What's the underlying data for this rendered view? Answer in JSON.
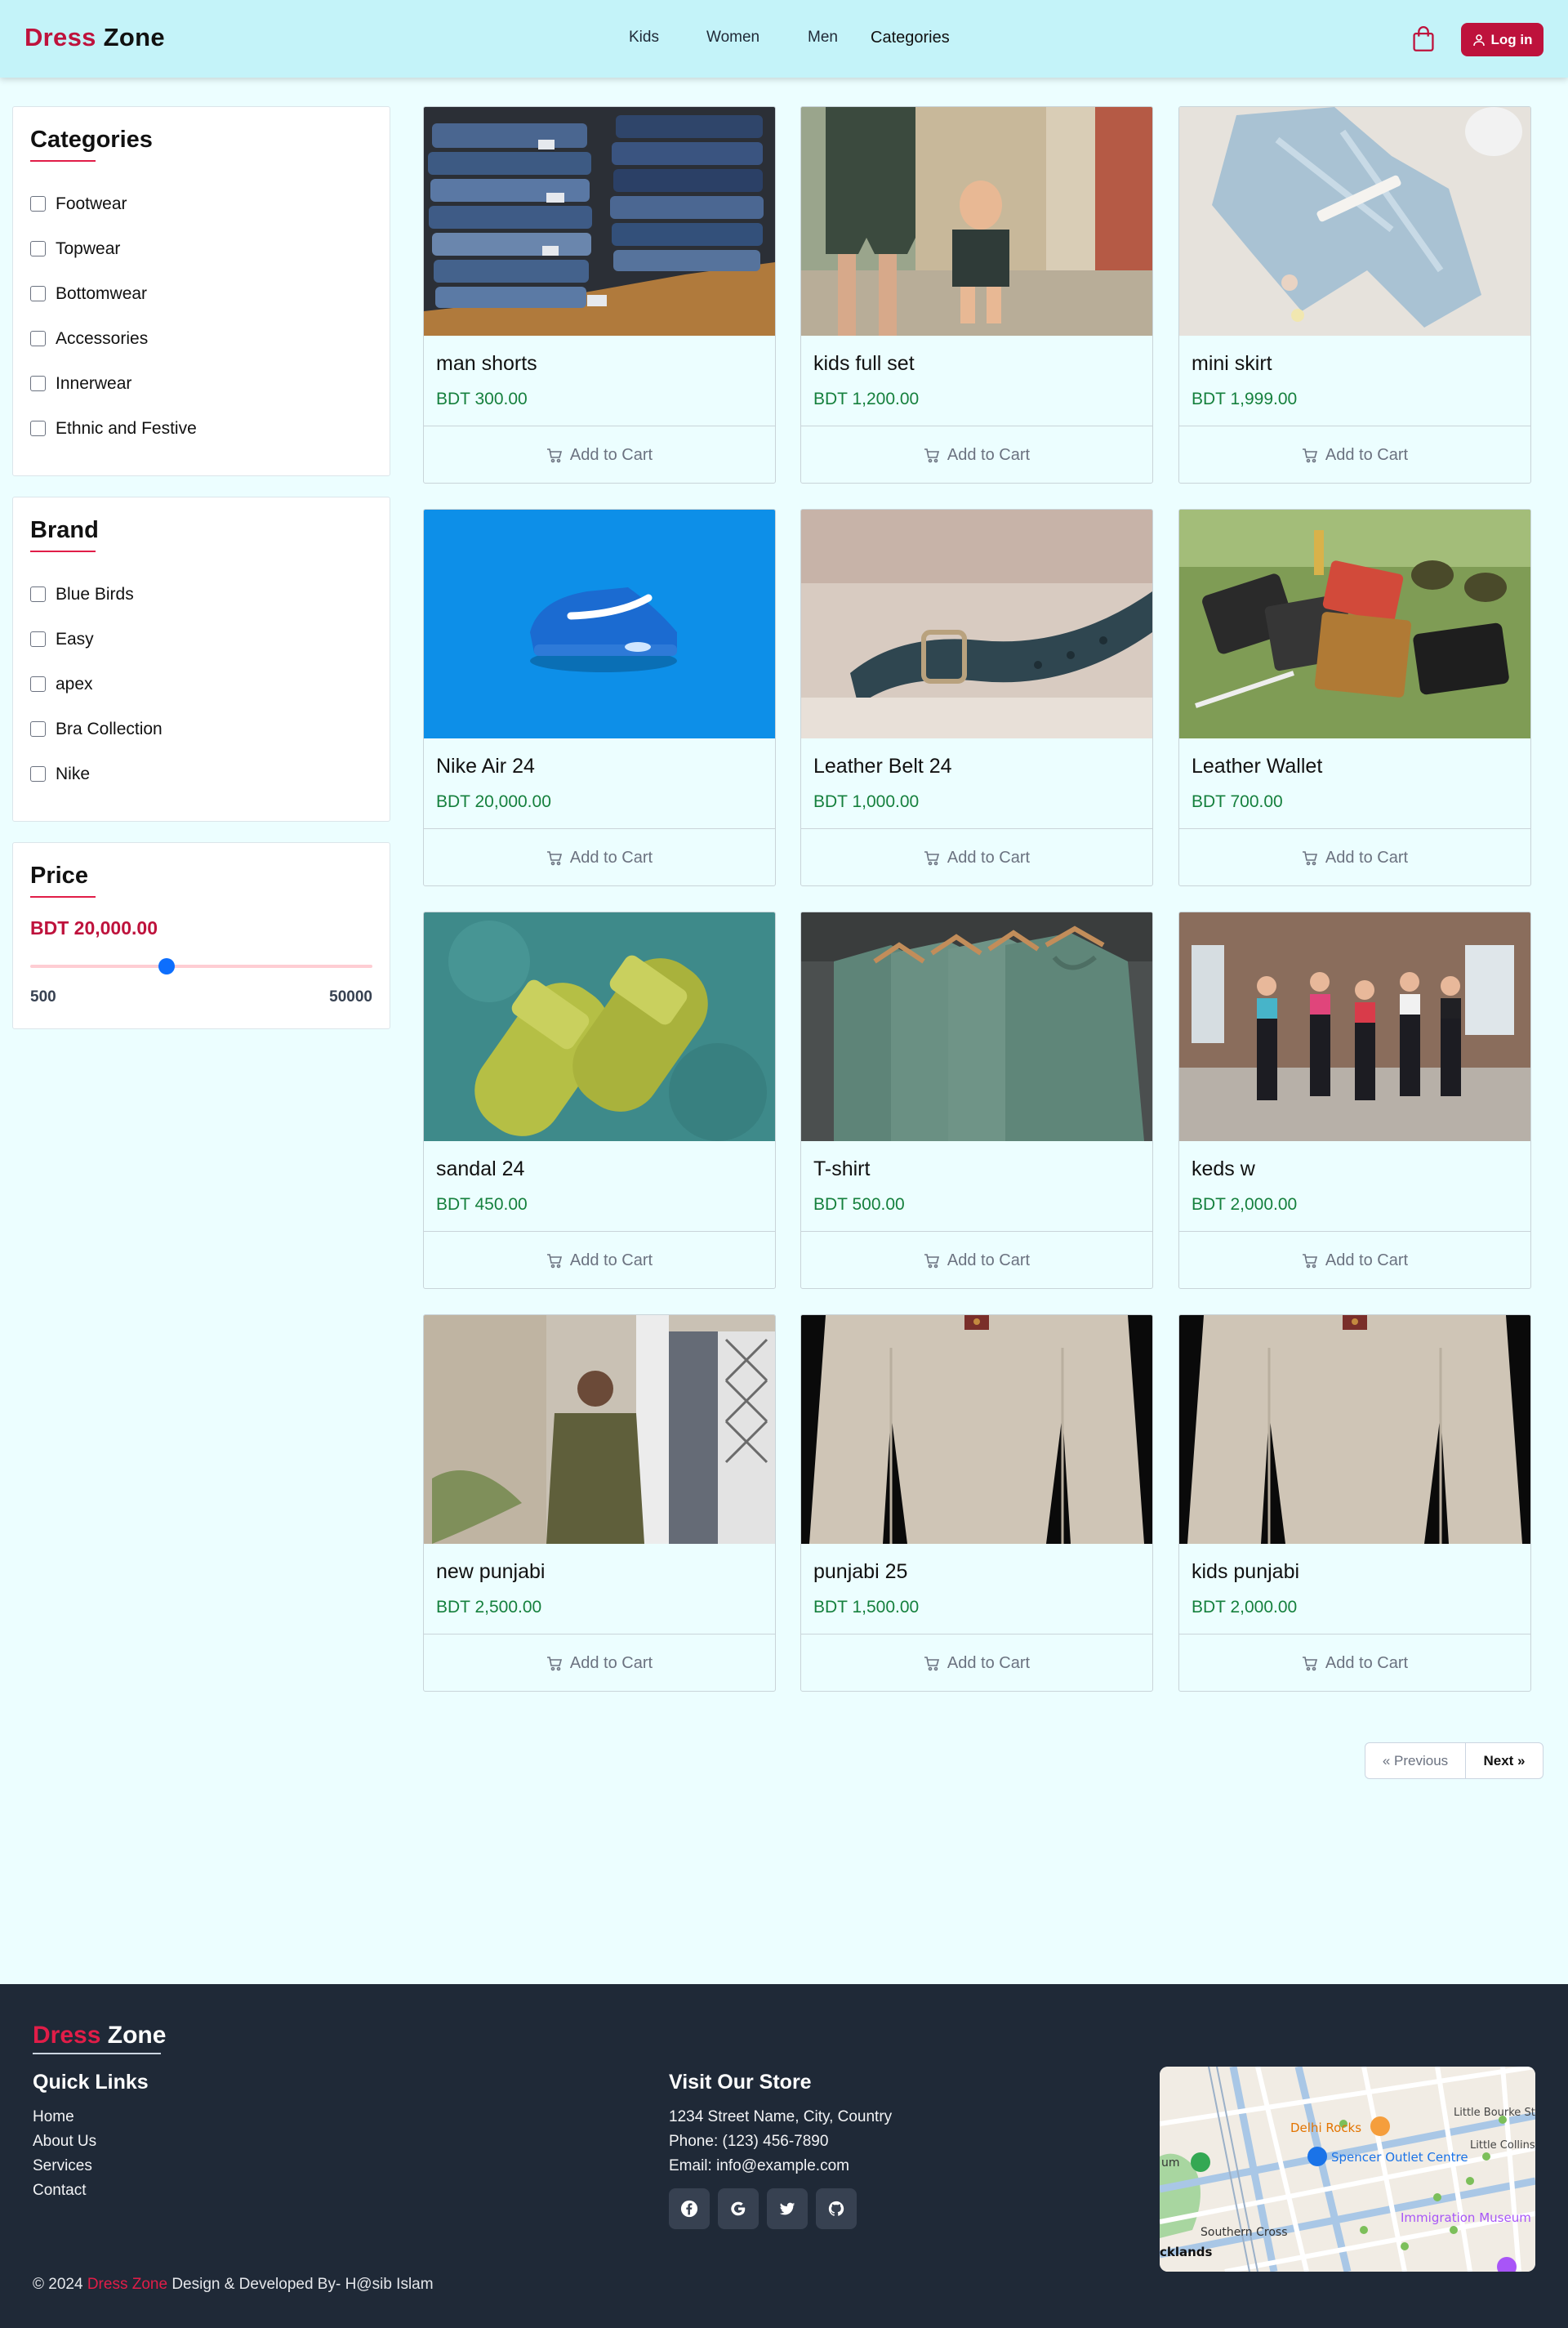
{
  "brand": {
    "part1": "Dress",
    "part2": "Zone"
  },
  "nav": {
    "kids": "Kids",
    "women": "Women",
    "men": "Men",
    "categories": "Categories",
    "login": "Log in"
  },
  "sidebar": {
    "categories_title": "Categories",
    "categories": [
      "Footwear",
      "Topwear",
      "Bottomwear",
      "Accessories",
      "Innerwear",
      "Ethnic and Festive"
    ],
    "brand_title": "Brand",
    "brands": [
      "Blue Birds",
      "Easy",
      "apex",
      "Bra Collection",
      "Nike"
    ],
    "price_title": "Price",
    "price_value": "BDT 20,000.00",
    "price_min": "500",
    "price_max": "50000",
    "price_slider_level": 20000
  },
  "products": [
    {
      "name": "man shorts",
      "price": "BDT 300.00",
      "cta": "Add to Cart"
    },
    {
      "name": "kids full set",
      "price": "BDT 1,200.00",
      "cta": "Add to Cart"
    },
    {
      "name": "mini skirt",
      "price": "BDT 1,999.00",
      "cta": "Add to Cart"
    },
    {
      "name": "Nike Air 24",
      "price": "BDT 20,000.00",
      "cta": "Add to Cart"
    },
    {
      "name": "Leather Belt 24",
      "price": "BDT 1,000.00",
      "cta": "Add to Cart"
    },
    {
      "name": "Leather Wallet",
      "price": "BDT 700.00",
      "cta": "Add to Cart"
    },
    {
      "name": "sandal 24",
      "price": "BDT 450.00",
      "cta": "Add to Cart"
    },
    {
      "name": "T-shirt",
      "price": "BDT 500.00",
      "cta": "Add to Cart"
    },
    {
      "name": "keds w",
      "price": "BDT 2,000.00",
      "cta": "Add to Cart"
    },
    {
      "name": "new punjabi",
      "price": "BDT 2,500.00",
      "cta": "Add to Cart"
    },
    {
      "name": "punjabi 25",
      "price": "BDT 1,500.00",
      "cta": "Add to Cart"
    },
    {
      "name": "kids punjabi",
      "price": "BDT 2,000.00",
      "cta": "Add to Cart"
    }
  ],
  "pagination": {
    "prev": "« Previous",
    "next": "Next »"
  },
  "footer": {
    "quick_links_title": "Quick Links",
    "quick_links": [
      "Home",
      "About Us",
      "Services",
      "Contact"
    ],
    "store_title": "Visit Our Store",
    "address": "1234 Street Name, City, Country",
    "phone": "Phone: (123) 456-7890",
    "email": "Email: info@example.com",
    "socials": [
      "facebook-icon",
      "google-icon",
      "twitter-icon",
      "github-icon"
    ],
    "map_labels": {
      "delhi": "Delhi Rocks",
      "spencer": "Spencer Outlet Centre",
      "bourke": "Little Bourke St",
      "collins": "Little Collins",
      "southern": "Southern Cross",
      "immigration": "Immigration Museum",
      "docklands": "cklands",
      "um": "um"
    },
    "copyright_prefix": "© 2024",
    "copyright_brand": "Dress Zone",
    "copyright_suffix": "Design & Developed By- H@sib Islam"
  },
  "colors": {
    "accent": "#be123c",
    "price_green": "#15803d",
    "page_bg": "#ecfeff",
    "footer_bg": "#1f2937",
    "nav_bg": "#c4f3f9"
  }
}
